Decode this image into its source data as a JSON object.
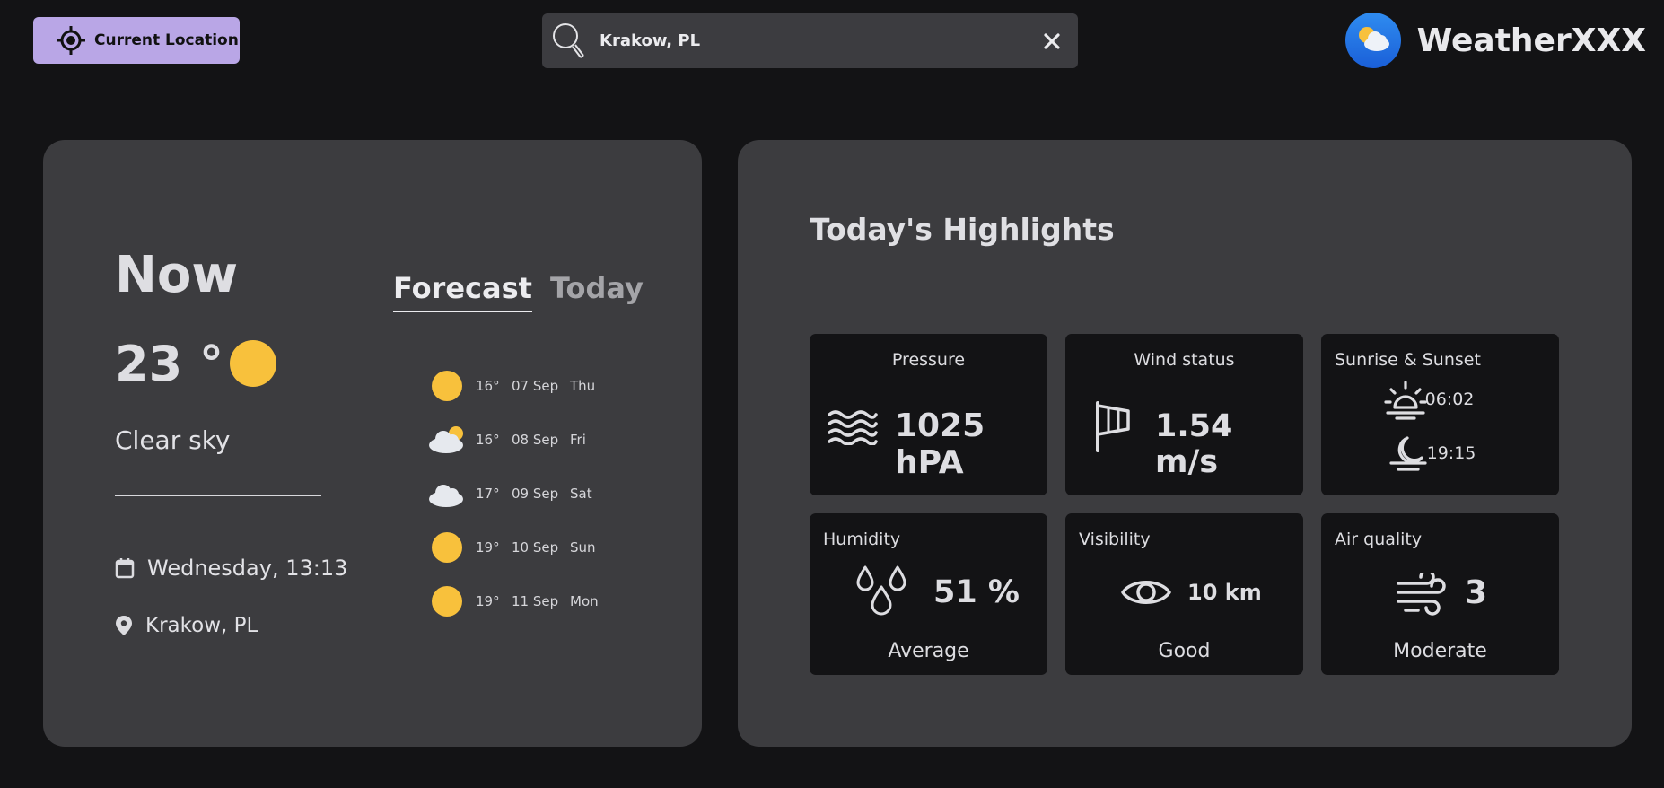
{
  "header": {
    "location_button_label": "Current Location",
    "search_value": "Krakow, PL",
    "brand_name": "WeatherXXX"
  },
  "now": {
    "title": "Now",
    "temperature": "23 °",
    "condition": "Clear sky",
    "datetime": "Wednesday,  13:13",
    "location": "Krakow, PL"
  },
  "tabs": [
    {
      "label": "Forecast",
      "active": true
    },
    {
      "label": "Today",
      "active": false
    }
  ],
  "forecast": [
    {
      "icon": "sun-icon",
      "temp": "16°",
      "date": "07 Sep",
      "day": "Thu"
    },
    {
      "icon": "partly-cloudy-icon",
      "temp": "16°",
      "date": "08 Sep",
      "day": "Fri"
    },
    {
      "icon": "cloud-icon",
      "temp": "17°",
      "date": "09 Sep",
      "day": "Sat"
    },
    {
      "icon": "sun-icon",
      "temp": "19°",
      "date": "10 Sep",
      "day": "Sun"
    },
    {
      "icon": "sun-icon",
      "temp": "19°",
      "date": "11 Sep",
      "day": "Mon"
    }
  ],
  "highlights": {
    "title": "Today's Highlights",
    "pressure": {
      "label": "Pressure",
      "value": "1025 hPA"
    },
    "wind": {
      "label": "Wind status",
      "value": "1.54 m/s"
    },
    "sun": {
      "label": "Sunrise & Sunset",
      "sunrise": "06:02",
      "sunset": "19:15"
    },
    "humidity": {
      "label": "Humidity",
      "value": "51 %",
      "status": "Average"
    },
    "visibility": {
      "label": "Visibility",
      "value": "10 km",
      "status": "Good"
    },
    "air_quality": {
      "label": "Air quality",
      "value": "3",
      "status": "Moderate"
    }
  },
  "colors": {
    "background": "#131315",
    "panel": "#3c3c3f",
    "card": "#131315",
    "accent_button": "#b9a6e6",
    "sun": "#f8c13c"
  }
}
